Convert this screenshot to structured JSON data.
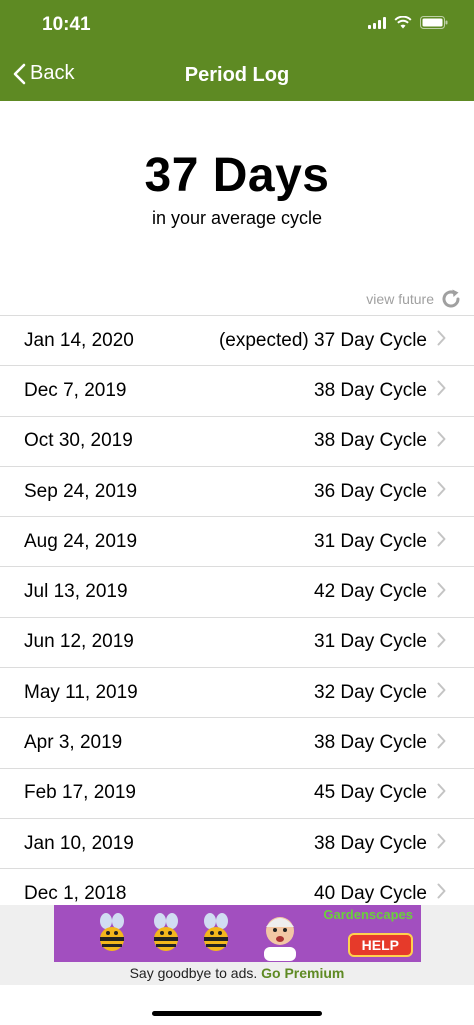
{
  "status_bar": {
    "time": "10:41"
  },
  "nav": {
    "back_label": "Back",
    "title": "Period Log"
  },
  "summary": {
    "average_days": "37 Days",
    "caption": "in your average cycle"
  },
  "view_future_label": "view future",
  "log": [
    {
      "date": "Jan 14, 2020",
      "cycle": "(expected) 37 Day Cycle"
    },
    {
      "date": "Dec 7, 2019",
      "cycle": "38 Day Cycle"
    },
    {
      "date": "Oct 30, 2019",
      "cycle": "38 Day Cycle"
    },
    {
      "date": "Sep 24, 2019",
      "cycle": "36 Day Cycle"
    },
    {
      "date": "Aug 24, 2019",
      "cycle": "31 Day Cycle"
    },
    {
      "date": "Jul 13, 2019",
      "cycle": "42 Day Cycle"
    },
    {
      "date": "Jun 12, 2019",
      "cycle": "31 Day Cycle"
    },
    {
      "date": "May 11, 2019",
      "cycle": "32 Day Cycle"
    },
    {
      "date": "Apr 3, 2019",
      "cycle": "38 Day Cycle"
    },
    {
      "date": "Feb 17, 2019",
      "cycle": "45 Day Cycle"
    },
    {
      "date": "Jan 10, 2019",
      "cycle": "38 Day Cycle"
    },
    {
      "date": "Dec 1, 2018",
      "cycle": "40 Day Cycle"
    }
  ],
  "ad": {
    "logo_text": "Gardenscapes",
    "help_label": "HELP",
    "message": "Say goodbye to ads.",
    "premium_link": "Go Premium"
  },
  "colors": {
    "brand_green": "#5e8a23",
    "ad_purple": "#a24fbf"
  }
}
